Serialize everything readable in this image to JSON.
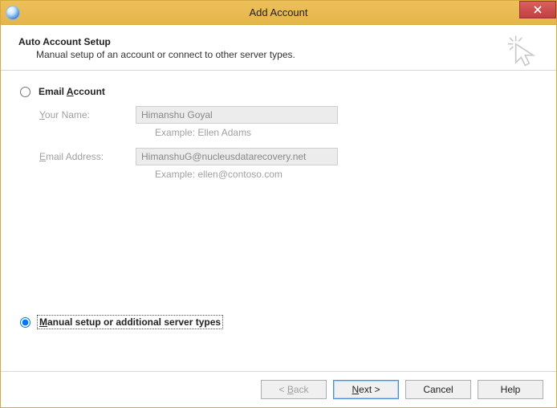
{
  "window": {
    "title": "Add Account"
  },
  "header": {
    "title": "Auto Account Setup",
    "subtitle": "Manual setup of an account or connect to other server types."
  },
  "options": {
    "email_account_label_prefix": "Email ",
    "email_account_label_ukey": "A",
    "email_account_label_suffix": "ccount",
    "manual_label_prefix": "",
    "manual_label_ukey": "M",
    "manual_label_suffix": "anual setup or additional server types",
    "selected": "manual"
  },
  "fields": {
    "your_name_label_prefix": "",
    "your_name_label_ukey": "Y",
    "your_name_label_suffix": "our Name:",
    "your_name_value": "Himanshu Goyal",
    "your_name_example": "Example: Ellen Adams",
    "email_label_prefix": "",
    "email_label_ukey": "E",
    "email_label_suffix": "mail Address:",
    "email_value": "HimanshuG@nucleusdatarecovery.net",
    "email_example": "Example: ellen@contoso.com"
  },
  "buttons": {
    "back_prefix": "< ",
    "back_ukey": "B",
    "back_suffix": "ack",
    "next_prefix": "",
    "next_ukey": "N",
    "next_suffix": "ext >",
    "cancel": "Cancel",
    "help": "Help"
  }
}
